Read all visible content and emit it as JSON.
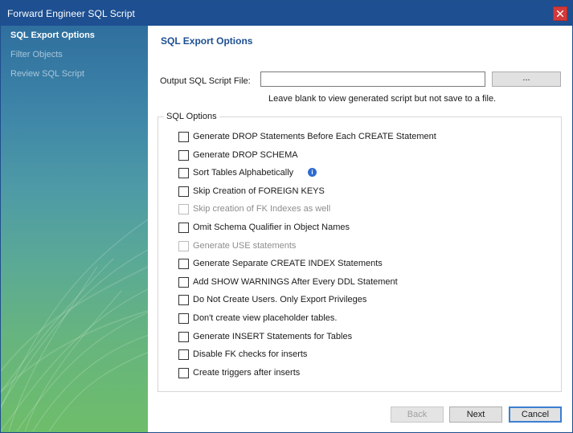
{
  "window": {
    "title": "Forward Engineer SQL Script"
  },
  "sidebar": {
    "items": [
      {
        "label": "SQL Export Options",
        "active": true
      },
      {
        "label": "Filter Objects",
        "active": false
      },
      {
        "label": "Review SQL Script",
        "active": false
      }
    ]
  },
  "main": {
    "heading": "SQL Export Options",
    "output_file": {
      "label": "Output SQL Script File:",
      "value": "",
      "browse_label": "...",
      "hint": "Leave blank to view generated script but not save to a file."
    },
    "group_title": "SQL Options",
    "options": [
      {
        "label": "Generate DROP Statements Before Each CREATE Statement",
        "checked": false,
        "enabled": true
      },
      {
        "label": "Generate DROP SCHEMA",
        "checked": false,
        "enabled": true
      },
      {
        "label": "Sort Tables Alphabetically",
        "checked": false,
        "enabled": true,
        "info_icon": "info-icon"
      },
      {
        "label": "Skip Creation of FOREIGN KEYS",
        "checked": false,
        "enabled": true
      },
      {
        "label": "Skip creation of FK Indexes as well",
        "checked": false,
        "enabled": false
      },
      {
        "label": "Omit Schema Qualifier in Object Names",
        "checked": false,
        "enabled": true
      },
      {
        "label": "Generate USE statements",
        "checked": false,
        "enabled": false
      },
      {
        "label": "Generate Separate CREATE INDEX Statements",
        "checked": false,
        "enabled": true
      },
      {
        "label": "Add SHOW WARNINGS After Every DDL Statement",
        "checked": false,
        "enabled": true
      },
      {
        "label": "Do Not Create Users. Only Export Privileges",
        "checked": false,
        "enabled": true
      },
      {
        "label": "Don't create view placeholder tables.",
        "checked": false,
        "enabled": true
      },
      {
        "label": "Generate INSERT Statements for Tables",
        "checked": false,
        "enabled": true
      },
      {
        "label": "Disable FK checks for inserts",
        "checked": false,
        "enabled": true
      },
      {
        "label": "Create triggers after inserts",
        "checked": false,
        "enabled": true
      }
    ]
  },
  "footer": {
    "back_label": "Back",
    "next_label": "Next",
    "cancel_label": "Cancel"
  },
  "colors": {
    "titlebar": "#1d4f91",
    "heading": "#1d4f91",
    "close": "#d33a3a",
    "info": "#2d6bd1"
  }
}
